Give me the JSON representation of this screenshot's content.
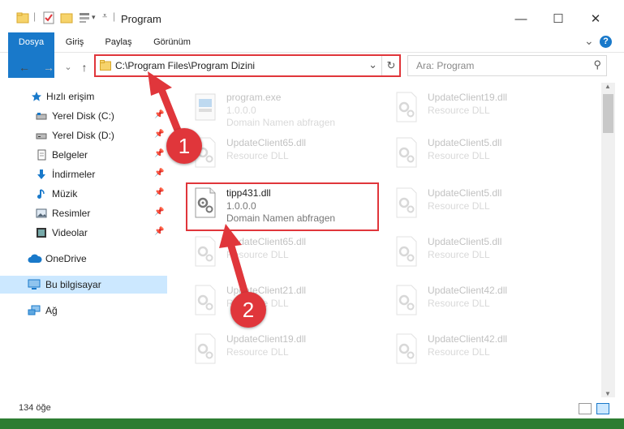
{
  "window": {
    "title": "Program",
    "minimize": "—",
    "maximize": "☐",
    "close": "✕"
  },
  "ribbon": {
    "tabs": [
      "Dosya",
      "Giriş",
      "Paylaş",
      "Görünüm"
    ],
    "collapse": "⌄",
    "help": "?"
  },
  "nav": {
    "back": "←",
    "forward": "→",
    "recent": "⌄",
    "up": "↑",
    "address": "C:\\Program Files\\Program Dizini",
    "address_dropdown": "⌄",
    "refresh": "↻",
    "search_placeholder": "Ara: Program",
    "search_icon": "⚲"
  },
  "sidebar": {
    "items": [
      {
        "label": "Hızlı erişim",
        "icon": "star-icon"
      },
      {
        "label": "Yerel Disk (C:)",
        "icon": "drive-icon",
        "pinned": "📌"
      },
      {
        "label": "Yerel Disk (D:)",
        "icon": "drive-icon",
        "pinned": "📌"
      },
      {
        "label": "Belgeler",
        "icon": "documents-icon",
        "pinned": "📌"
      },
      {
        "label": "İndirmeler",
        "icon": "download-icon",
        "pinned": "📌"
      },
      {
        "label": "Müzik",
        "icon": "music-icon",
        "pinned": "📌"
      },
      {
        "label": "Resimler",
        "icon": "pictures-icon",
        "pinned": "📌"
      },
      {
        "label": "Videolar",
        "icon": "video-icon",
        "pinned": "📌"
      },
      {
        "label": "OneDrive",
        "icon": "cloud-icon"
      },
      {
        "label": "Bu bilgisayar",
        "icon": "computer-icon"
      },
      {
        "label": "Ağ",
        "icon": "network-icon"
      }
    ]
  },
  "files": {
    "left": [
      {
        "name": "program.exe",
        "line1": "1.0.0.0",
        "line2": "Domain Namen abfragen",
        "kind": "exe"
      },
      {
        "name": "UpdateClient65.dll",
        "line1": "Resource DLL",
        "line2": "",
        "kind": "dll"
      },
      {
        "name": "tipp431.dll",
        "line1": "1.0.0.0",
        "line2": "Domain Namen abfragen",
        "kind": "dll"
      },
      {
        "name": "UpdateClient65.dll",
        "line1": "Resource DLL",
        "line2": "",
        "kind": "dll"
      },
      {
        "name": "UpdateClient21.dll",
        "line1": "Resource DLL",
        "line2": "",
        "kind": "dll"
      },
      {
        "name": "UpdateClient19.dll",
        "line1": "Resource DLL",
        "line2": "",
        "kind": "dll"
      }
    ],
    "right": [
      {
        "name": "UpdateClient19.dll",
        "line1": "Resource DLL",
        "kind": "dll"
      },
      {
        "name": "UpdateClient5.dll",
        "line1": "Resource DLL",
        "kind": "dll"
      },
      {
        "name": "UpdateClient5.dll",
        "line1": "Resource DLL",
        "kind": "dll"
      },
      {
        "name": "UpdateClient5.dll",
        "line1": "Resource DLL",
        "kind": "dll"
      },
      {
        "name": "UpdateClient42.dll",
        "line1": "Resource DLL",
        "kind": "dll"
      },
      {
        "name": "UpdateClient42.dll",
        "line1": "Resource DLL",
        "kind": "dll"
      }
    ]
  },
  "status": {
    "count": "134 öğe"
  },
  "annotations": {
    "step1": "1",
    "step2": "2",
    "color": "#e0363b"
  },
  "colors": {
    "accent": "#1979ca",
    "selected": "#cce8ff",
    "highlight": "#e0363b"
  }
}
